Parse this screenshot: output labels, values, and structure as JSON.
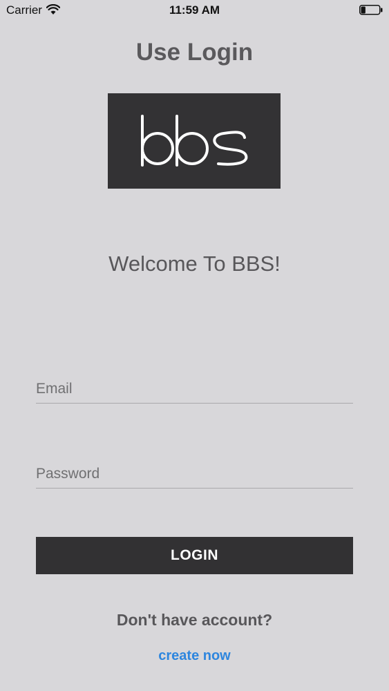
{
  "status_bar": {
    "carrier": "Carrier",
    "time": "11:59 AM",
    "wifi_icon": "wifi-icon",
    "battery_icon": "battery-icon",
    "battery_level": 0.25
  },
  "header": {
    "title": "Use Login"
  },
  "logo": {
    "text": "bbs",
    "background": "#333234",
    "color": "#ffffff"
  },
  "welcome": "Welcome To BBS!",
  "form": {
    "email_placeholder": "Email",
    "email_value": "",
    "password_placeholder": "Password",
    "password_value": "",
    "login_label": "LOGIN"
  },
  "footer": {
    "prompt": "Don't have account?",
    "link_label": "create now",
    "link_color": "#2e86de"
  },
  "colors": {
    "background": "#d8d7da",
    "button": "#323133",
    "text": "#58575a"
  }
}
